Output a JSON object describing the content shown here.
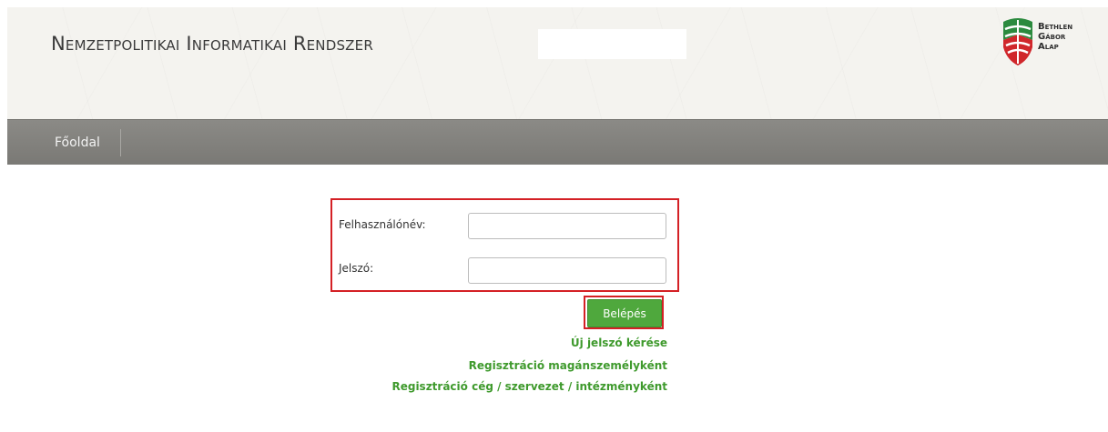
{
  "header": {
    "title": "Nemzetpolitikai Informatikai Rendszer",
    "logo": {
      "line1": "Bethlen",
      "line2": "Gábor",
      "line3": "Alap",
      "colors": {
        "green": "#2b8a3e",
        "red": "#d0262b"
      }
    }
  },
  "nav": {
    "items": [
      {
        "label": "Főoldal"
      }
    ]
  },
  "login": {
    "username_label": "Felhasználónév:",
    "username_value": "",
    "password_label": "Jelszó:",
    "password_value": "",
    "submit_label": "Belépés",
    "highlight_color": "#d42025"
  },
  "links": {
    "new_password": "Új jelszó kérése",
    "register_private": "Regisztráció magánszemélyként",
    "register_org": "Regisztráció cég / szervezet / intézményként"
  },
  "colors": {
    "accent_green": "#4fa83d",
    "link_green": "#3f9a2d"
  }
}
